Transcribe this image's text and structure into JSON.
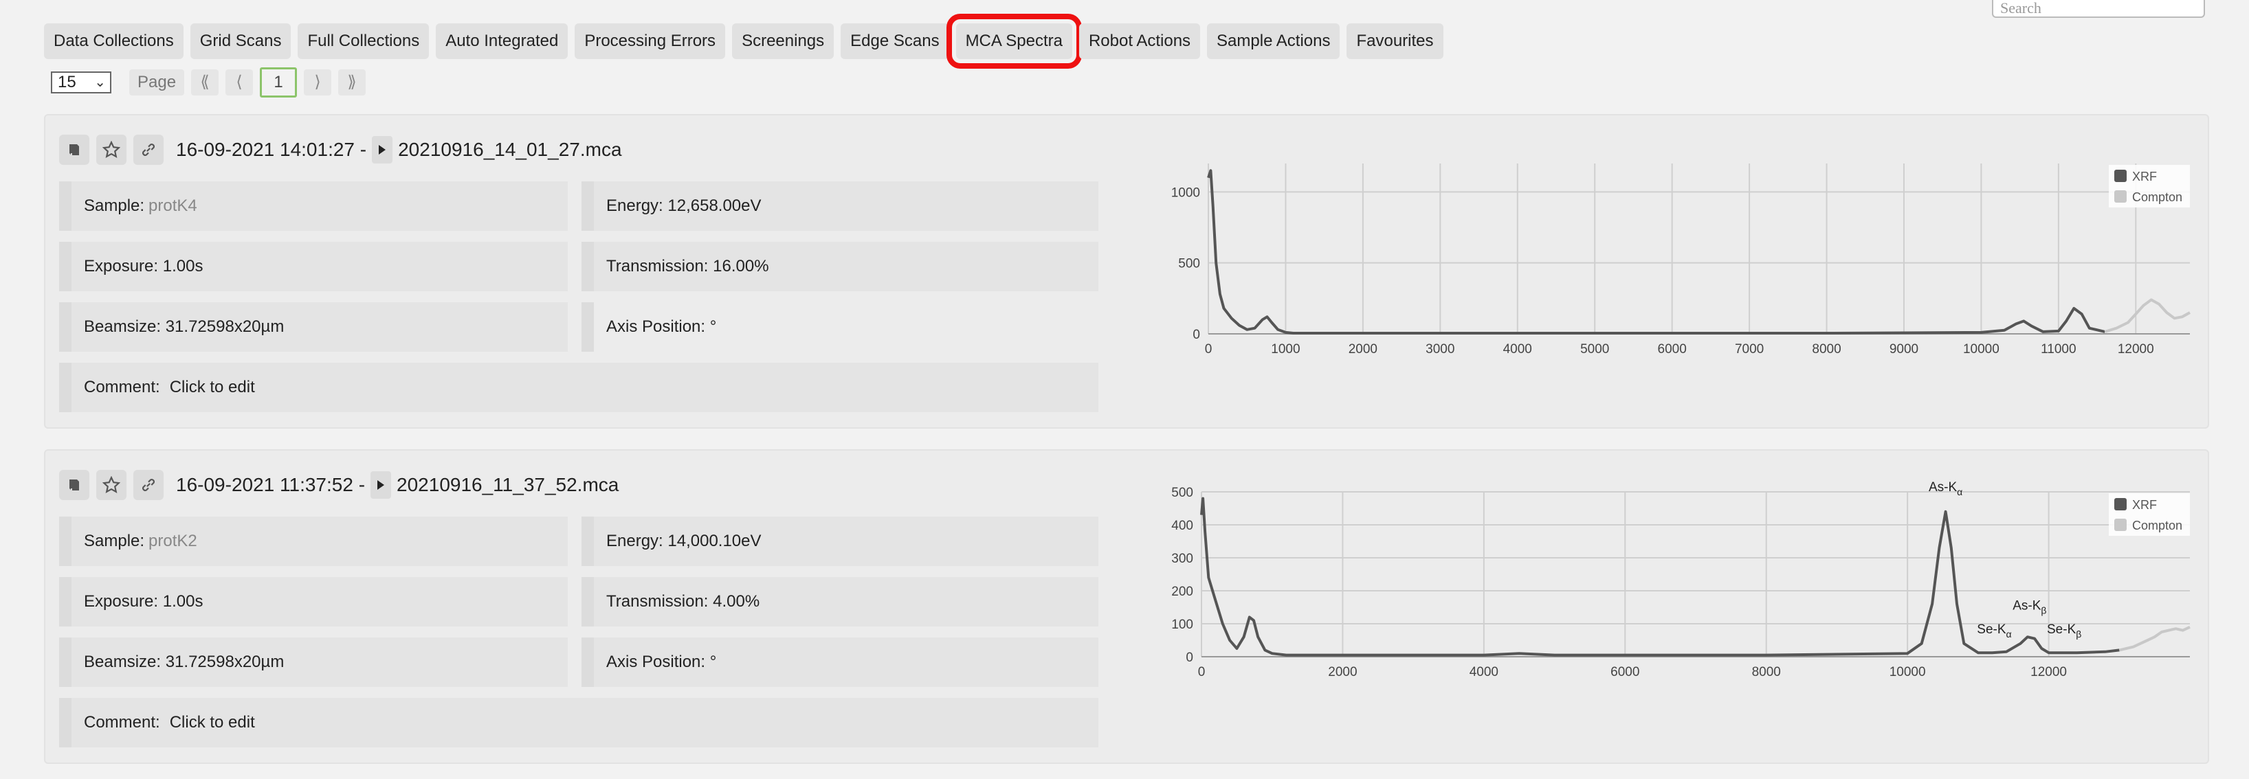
{
  "search": {
    "placeholder": "Search"
  },
  "tabs": [
    {
      "label": "Data Collections"
    },
    {
      "label": "Grid Scans"
    },
    {
      "label": "Full Collections"
    },
    {
      "label": "Auto Integrated"
    },
    {
      "label": "Processing Errors"
    },
    {
      "label": "Screenings"
    },
    {
      "label": "Edge Scans"
    },
    {
      "label": "MCA Spectra",
      "active": true
    },
    {
      "label": "Robot Actions"
    },
    {
      "label": "Sample Actions"
    },
    {
      "label": "Favourites"
    }
  ],
  "pager": {
    "page_size": "15",
    "page_label": "Page",
    "first": "⟪",
    "prev": "⟨",
    "current": "1",
    "next": "⟩",
    "last": "⟫"
  },
  "accent_color": "#ee1111",
  "entries": [
    {
      "datetime": "16-09-2021 14:01:27 -",
      "filename": "20210916_14_01_27.mca",
      "sample_label": "Sample:",
      "sample_value": "protK4",
      "energy": "Energy: 12,658.00eV",
      "exposure": "Exposure: 1.00s",
      "transmission": "Transmission: 16.00%",
      "beamsize": "Beamsize: 31.72598x20µm",
      "axis_position": "Axis Position: °",
      "comment_label": "Comment:",
      "comment_value": "Click to edit"
    },
    {
      "datetime": "16-09-2021 11:37:52 -",
      "filename": "20210916_11_37_52.mca",
      "sample_label": "Sample:",
      "sample_value": "protK2",
      "energy": "Energy: 14,000.10eV",
      "exposure": "Exposure: 1.00s",
      "transmission": "Transmission: 4.00%",
      "beamsize": "Beamsize: 31.72598x20µm",
      "axis_position": "Axis Position: °",
      "comment_label": "Comment:",
      "comment_value": "Click to edit"
    }
  ],
  "chart_data": [
    {
      "type": "line",
      "xlim": [
        0,
        12700
      ],
      "ylim": [
        0,
        1200
      ],
      "xticks": [
        0,
        1000,
        2000,
        3000,
        4000,
        5000,
        6000,
        7000,
        8000,
        9000,
        10000,
        11000,
        12000
      ],
      "yticks": [
        0,
        500,
        1000
      ],
      "grid": true,
      "legend": "top-right",
      "series": [
        {
          "name": "XRF",
          "color": "#555555",
          "x": [
            0,
            30,
            60,
            100,
            150,
            200,
            300,
            400,
            500,
            600,
            700,
            760,
            820,
            900,
            1000,
            1100,
            2000,
            4000,
            6000,
            8000,
            10000,
            10300,
            10450,
            10550,
            10650,
            10800,
            11000,
            11100,
            11200,
            11300,
            11400,
            11600
          ],
          "y": [
            1100,
            1150,
            900,
            500,
            280,
            180,
            110,
            60,
            30,
            40,
            100,
            120,
            80,
            30,
            10,
            5,
            5,
            5,
            5,
            5,
            10,
            25,
            70,
            90,
            55,
            15,
            20,
            90,
            180,
            140,
            40,
            15
          ]
        },
        {
          "name": "Compton",
          "color": "#c8c8c8",
          "x": [
            11600,
            11750,
            11900,
            12000,
            12100,
            12200,
            12300,
            12400,
            12500,
            12600,
            12700
          ],
          "y": [
            15,
            40,
            80,
            140,
            200,
            240,
            210,
            150,
            110,
            120,
            150
          ]
        }
      ]
    },
    {
      "type": "line",
      "xlim": [
        0,
        14000
      ],
      "ylim": [
        0,
        500
      ],
      "xticks": [
        0,
        2000,
        4000,
        6000,
        8000,
        10000,
        12000
      ],
      "yticks": [
        0,
        100,
        200,
        300,
        400,
        500
      ],
      "grid": true,
      "legend": "top-right",
      "annotations": [
        {
          "main": "As-K",
          "sub": "α",
          "x": 10540,
          "y": 490
        },
        {
          "main": "As-K",
          "sub": "β",
          "x": 11730,
          "y": 130
        },
        {
          "main": "Se-K",
          "sub": "α",
          "x": 11230,
          "y": 58
        },
        {
          "main": "Se-K",
          "sub": "β",
          "x": 12220,
          "y": 58
        }
      ],
      "series": [
        {
          "name": "XRF",
          "color": "#555555",
          "x": [
            0,
            20,
            50,
            100,
            200,
            300,
            400,
            500,
            600,
            680,
            740,
            800,
            900,
            1000,
            1200,
            2000,
            4000,
            4500,
            5000,
            8000,
            10000,
            10200,
            10350,
            10450,
            10540,
            10620,
            10700,
            10800,
            11000,
            11200,
            11400,
            11600,
            11700,
            11800,
            11900,
            12000,
            12400,
            12800,
            13000
          ],
          "y": [
            430,
            480,
            380,
            240,
            170,
            100,
            50,
            25,
            60,
            120,
            110,
            60,
            20,
            10,
            5,
            5,
            5,
            10,
            5,
            5,
            10,
            40,
            160,
            330,
            440,
            330,
            160,
            40,
            12,
            12,
            15,
            40,
            60,
            55,
            25,
            12,
            12,
            15,
            20
          ]
        },
        {
          "name": "Compton",
          "color": "#c8c8c8",
          "x": [
            13000,
            13200,
            13400,
            13500,
            13600,
            13700,
            13800,
            13900,
            14000
          ],
          "y": [
            20,
            30,
            50,
            60,
            75,
            80,
            85,
            80,
            90
          ]
        }
      ]
    }
  ]
}
